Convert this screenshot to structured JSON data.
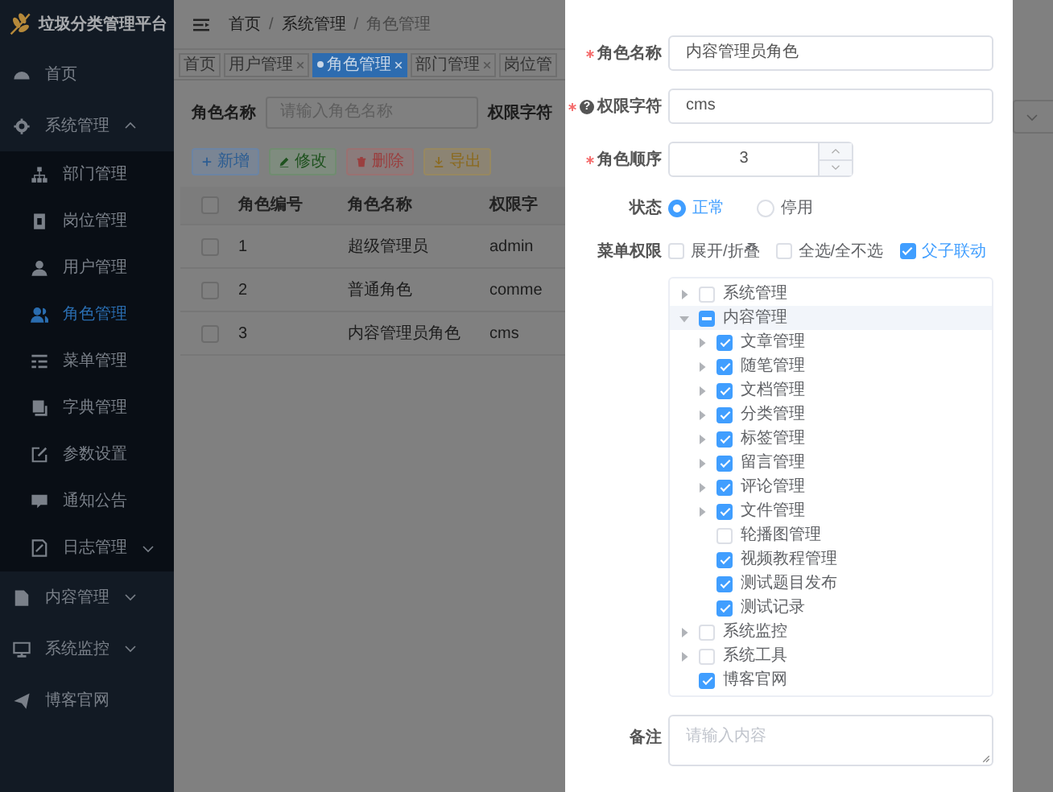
{
  "sidebar": {
    "title": "垃圾分类管理平台",
    "items": [
      {
        "label": "首页",
        "selected": false
      },
      {
        "label": "系统管理",
        "selected": false,
        "expanded": true,
        "children": [
          {
            "label": "部门管理",
            "selected": false
          },
          {
            "label": "岗位管理",
            "selected": false
          },
          {
            "label": "用户管理",
            "selected": false
          },
          {
            "label": "角色管理",
            "selected": true
          },
          {
            "label": "菜单管理",
            "selected": false
          },
          {
            "label": "字典管理",
            "selected": false
          },
          {
            "label": "参数设置",
            "selected": false
          },
          {
            "label": "通知公告",
            "selected": false
          },
          {
            "label": "日志管理",
            "selected": false,
            "expanded": false
          }
        ]
      },
      {
        "label": "内容管理",
        "selected": false,
        "expanded": false
      },
      {
        "label": "系统监控",
        "selected": false,
        "expanded": false
      },
      {
        "label": "博客官网",
        "selected": false
      }
    ]
  },
  "header": {
    "breadcrumb": [
      {
        "kind": "link",
        "text": "首页"
      },
      {
        "kind": "separator",
        "text": "/"
      },
      {
        "kind": "link",
        "text": "系统管理"
      },
      {
        "kind": "separator",
        "text": "/"
      },
      {
        "kind": "current",
        "text": "角色管理"
      }
    ]
  },
  "tags": [
    {
      "label": "首页",
      "selected": false,
      "closable": false
    },
    {
      "label": "用户管理",
      "selected": false,
      "closable": true
    },
    {
      "label": "角色管理",
      "selected": true,
      "closable": true
    },
    {
      "label": "部门管理",
      "selected": false,
      "closable": true
    },
    {
      "label": "岗位管",
      "selected": false,
      "closable": false
    }
  ],
  "search": [
    {
      "label": "角色名称",
      "placeholder": "请输入角色名称"
    },
    {
      "label": "权限字符"
    }
  ],
  "toolbar": [
    {
      "kind": "primary",
      "label": "新增"
    },
    {
      "kind": "success",
      "label": "修改"
    },
    {
      "kind": "danger",
      "label": "删除"
    },
    {
      "kind": "warning",
      "label": "导出"
    }
  ],
  "table": {
    "all_selected": false,
    "columns": [
      "角色编号",
      "角色名称",
      "权限字"
    ],
    "rows": [
      {
        "selected": false,
        "cells": [
          "1",
          "超级管理员",
          "admin"
        ]
      },
      {
        "selected": false,
        "cells": [
          "2",
          "普通角色",
          "comme"
        ]
      },
      {
        "selected": false,
        "cells": [
          "3",
          "内容管理员角色",
          "cms"
        ]
      }
    ]
  },
  "drawer": {
    "fields": [
      {
        "kind": "text",
        "label": "角色名称",
        "required": true,
        "value": "内容管理员角色"
      },
      {
        "kind": "text",
        "label": "权限字符",
        "required": true,
        "help": "?",
        "value": "cms"
      },
      {
        "kind": "number",
        "label": "角色顺序",
        "required": true,
        "value": "3"
      },
      {
        "kind": "radio",
        "label": "状态",
        "required": false,
        "options": [
          {
            "label": "正常",
            "selected": true
          },
          {
            "label": "停用",
            "selected": false
          }
        ]
      },
      {
        "kind": "tree",
        "label": "菜单权限",
        "required": false,
        "options": [
          {
            "label": "展开/折叠",
            "checked": false
          },
          {
            "label": "全选/全不选",
            "checked": false
          },
          {
            "label": "父子联动",
            "checked": true
          }
        ],
        "tree": [
          {
            "label": "系统管理",
            "checked": false,
            "expanded": false,
            "selected": false
          },
          {
            "label": "内容管理",
            "checked": false,
            "indeterminate": true,
            "expanded": true,
            "selected": true,
            "children": [
              {
                "label": "文章管理",
                "checked": true,
                "expanded": false,
                "selected": false
              },
              {
                "label": "随笔管理",
                "checked": true,
                "expanded": false,
                "selected": false
              },
              {
                "label": "文档管理",
                "checked": true,
                "expanded": false,
                "selected": false
              },
              {
                "label": "分类管理",
                "checked": true,
                "expanded": false,
                "selected": false
              },
              {
                "label": "标签管理",
                "checked": true,
                "expanded": false,
                "selected": false
              },
              {
                "label": "留言管理",
                "checked": true,
                "expanded": false,
                "selected": false
              },
              {
                "label": "评论管理",
                "checked": true,
                "expanded": false,
                "selected": false
              },
              {
                "label": "文件管理",
                "checked": true,
                "expanded": false,
                "selected": false
              },
              {
                "label": "轮播图管理",
                "checked": false,
                "selected": false
              },
              {
                "label": "视频教程管理",
                "checked": true,
                "selected": false
              },
              {
                "label": "测试题目发布",
                "checked": true,
                "selected": false
              },
              {
                "label": "测试记录",
                "checked": true,
                "selected": false
              }
            ]
          },
          {
            "label": "系统监控",
            "checked": false,
            "expanded": false,
            "selected": false
          },
          {
            "label": "系统工具",
            "checked": false,
            "expanded": false,
            "selected": false
          },
          {
            "label": "博客官网",
            "checked": true,
            "selected": false
          }
        ]
      },
      {
        "kind": "textarea",
        "label": "备注",
        "required": false,
        "placeholder": "请输入内容"
      }
    ]
  }
}
